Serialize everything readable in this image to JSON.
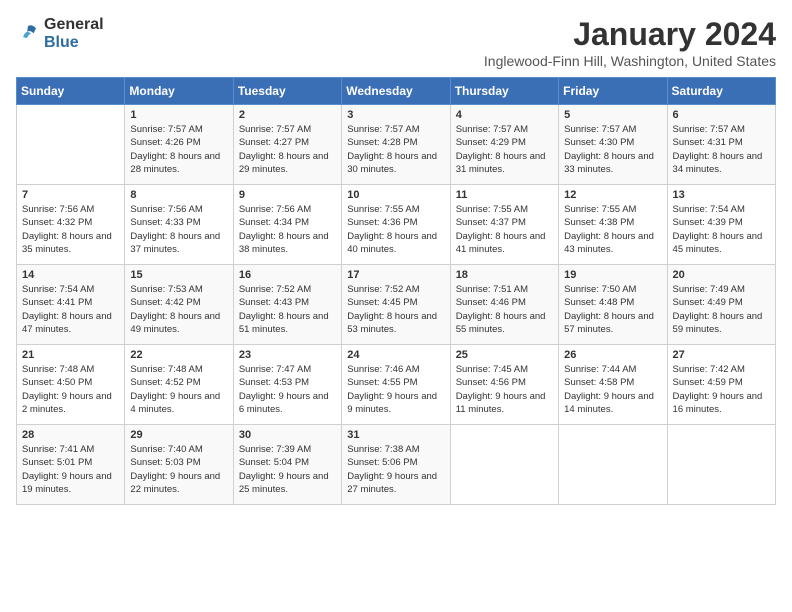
{
  "logo": {
    "general": "General",
    "blue": "Blue"
  },
  "header": {
    "title": "January 2024",
    "location": "Inglewood-Finn Hill, Washington, United States"
  },
  "days_of_week": [
    "Sunday",
    "Monday",
    "Tuesday",
    "Wednesday",
    "Thursday",
    "Friday",
    "Saturday"
  ],
  "weeks": [
    [
      {
        "day": "",
        "sunrise": "",
        "sunset": "",
        "daylight": ""
      },
      {
        "day": "1",
        "sunrise": "7:57 AM",
        "sunset": "4:26 PM",
        "daylight": "8 hours and 28 minutes."
      },
      {
        "day": "2",
        "sunrise": "7:57 AM",
        "sunset": "4:27 PM",
        "daylight": "8 hours and 29 minutes."
      },
      {
        "day": "3",
        "sunrise": "7:57 AM",
        "sunset": "4:28 PM",
        "daylight": "8 hours and 30 minutes."
      },
      {
        "day": "4",
        "sunrise": "7:57 AM",
        "sunset": "4:29 PM",
        "daylight": "8 hours and 31 minutes."
      },
      {
        "day": "5",
        "sunrise": "7:57 AM",
        "sunset": "4:30 PM",
        "daylight": "8 hours and 33 minutes."
      },
      {
        "day": "6",
        "sunrise": "7:57 AM",
        "sunset": "4:31 PM",
        "daylight": "8 hours and 34 minutes."
      }
    ],
    [
      {
        "day": "7",
        "sunrise": "7:56 AM",
        "sunset": "4:32 PM",
        "daylight": "8 hours and 35 minutes."
      },
      {
        "day": "8",
        "sunrise": "7:56 AM",
        "sunset": "4:33 PM",
        "daylight": "8 hours and 37 minutes."
      },
      {
        "day": "9",
        "sunrise": "7:56 AM",
        "sunset": "4:34 PM",
        "daylight": "8 hours and 38 minutes."
      },
      {
        "day": "10",
        "sunrise": "7:55 AM",
        "sunset": "4:36 PM",
        "daylight": "8 hours and 40 minutes."
      },
      {
        "day": "11",
        "sunrise": "7:55 AM",
        "sunset": "4:37 PM",
        "daylight": "8 hours and 41 minutes."
      },
      {
        "day": "12",
        "sunrise": "7:55 AM",
        "sunset": "4:38 PM",
        "daylight": "8 hours and 43 minutes."
      },
      {
        "day": "13",
        "sunrise": "7:54 AM",
        "sunset": "4:39 PM",
        "daylight": "8 hours and 45 minutes."
      }
    ],
    [
      {
        "day": "14",
        "sunrise": "7:54 AM",
        "sunset": "4:41 PM",
        "daylight": "8 hours and 47 minutes."
      },
      {
        "day": "15",
        "sunrise": "7:53 AM",
        "sunset": "4:42 PM",
        "daylight": "8 hours and 49 minutes."
      },
      {
        "day": "16",
        "sunrise": "7:52 AM",
        "sunset": "4:43 PM",
        "daylight": "8 hours and 51 minutes."
      },
      {
        "day": "17",
        "sunrise": "7:52 AM",
        "sunset": "4:45 PM",
        "daylight": "8 hours and 53 minutes."
      },
      {
        "day": "18",
        "sunrise": "7:51 AM",
        "sunset": "4:46 PM",
        "daylight": "8 hours and 55 minutes."
      },
      {
        "day": "19",
        "sunrise": "7:50 AM",
        "sunset": "4:48 PM",
        "daylight": "8 hours and 57 minutes."
      },
      {
        "day": "20",
        "sunrise": "7:49 AM",
        "sunset": "4:49 PM",
        "daylight": "8 hours and 59 minutes."
      }
    ],
    [
      {
        "day": "21",
        "sunrise": "7:48 AM",
        "sunset": "4:50 PM",
        "daylight": "9 hours and 2 minutes."
      },
      {
        "day": "22",
        "sunrise": "7:48 AM",
        "sunset": "4:52 PM",
        "daylight": "9 hours and 4 minutes."
      },
      {
        "day": "23",
        "sunrise": "7:47 AM",
        "sunset": "4:53 PM",
        "daylight": "9 hours and 6 minutes."
      },
      {
        "day": "24",
        "sunrise": "7:46 AM",
        "sunset": "4:55 PM",
        "daylight": "9 hours and 9 minutes."
      },
      {
        "day": "25",
        "sunrise": "7:45 AM",
        "sunset": "4:56 PM",
        "daylight": "9 hours and 11 minutes."
      },
      {
        "day": "26",
        "sunrise": "7:44 AM",
        "sunset": "4:58 PM",
        "daylight": "9 hours and 14 minutes."
      },
      {
        "day": "27",
        "sunrise": "7:42 AM",
        "sunset": "4:59 PM",
        "daylight": "9 hours and 16 minutes."
      }
    ],
    [
      {
        "day": "28",
        "sunrise": "7:41 AM",
        "sunset": "5:01 PM",
        "daylight": "9 hours and 19 minutes."
      },
      {
        "day": "29",
        "sunrise": "7:40 AM",
        "sunset": "5:03 PM",
        "daylight": "9 hours and 22 minutes."
      },
      {
        "day": "30",
        "sunrise": "7:39 AM",
        "sunset": "5:04 PM",
        "daylight": "9 hours and 25 minutes."
      },
      {
        "day": "31",
        "sunrise": "7:38 AM",
        "sunset": "5:06 PM",
        "daylight": "9 hours and 27 minutes."
      },
      {
        "day": "",
        "sunrise": "",
        "sunset": "",
        "daylight": ""
      },
      {
        "day": "",
        "sunrise": "",
        "sunset": "",
        "daylight": ""
      },
      {
        "day": "",
        "sunrise": "",
        "sunset": "",
        "daylight": ""
      }
    ]
  ]
}
